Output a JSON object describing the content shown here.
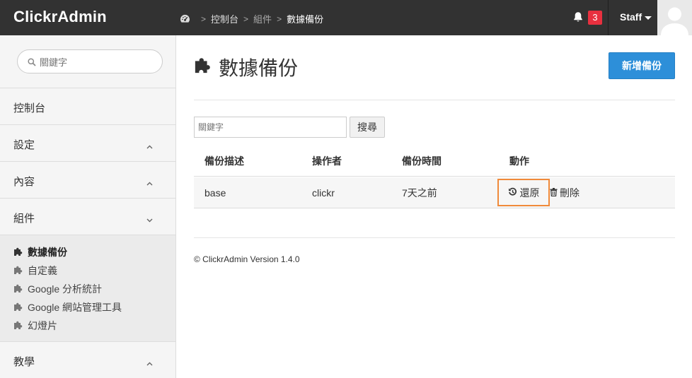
{
  "app": {
    "brand": "ClickrAdmin"
  },
  "breadcrumb": {
    "items": [
      "控制台",
      "組件",
      "數據備份"
    ]
  },
  "header": {
    "notification_count": "3",
    "user_label": "Staff"
  },
  "sidebar": {
    "search_placeholder": "關鍵字",
    "items": [
      {
        "label": "控制台"
      },
      {
        "label": "設定"
      },
      {
        "label": "內容"
      },
      {
        "label": "組件"
      }
    ],
    "submenu": [
      {
        "label": "數據備份"
      },
      {
        "label": "自定義"
      },
      {
        "label": "Google 分析統計"
      },
      {
        "label": "Google 網站管理工具"
      },
      {
        "label": "幻燈片"
      }
    ],
    "last_item": {
      "label": "教學"
    }
  },
  "main": {
    "title": "數據備份",
    "add_button": "新增備份",
    "keyword_placeholder": "關鍵字",
    "search_button": "搜尋",
    "table": {
      "headers": [
        "備份描述",
        "操作者",
        "備份時間",
        "動作"
      ],
      "rows": [
        {
          "description": "base",
          "operator": "clickr",
          "time": "7天之前",
          "restore": "還原",
          "delete": "刪除"
        }
      ]
    },
    "footer": "© ClickrAdmin Version 1.4.0"
  },
  "colors": {
    "topbar": "#323232",
    "primary_button": "#2d8fd9",
    "badge": "#e8303f",
    "highlight": "#f08a3a"
  }
}
